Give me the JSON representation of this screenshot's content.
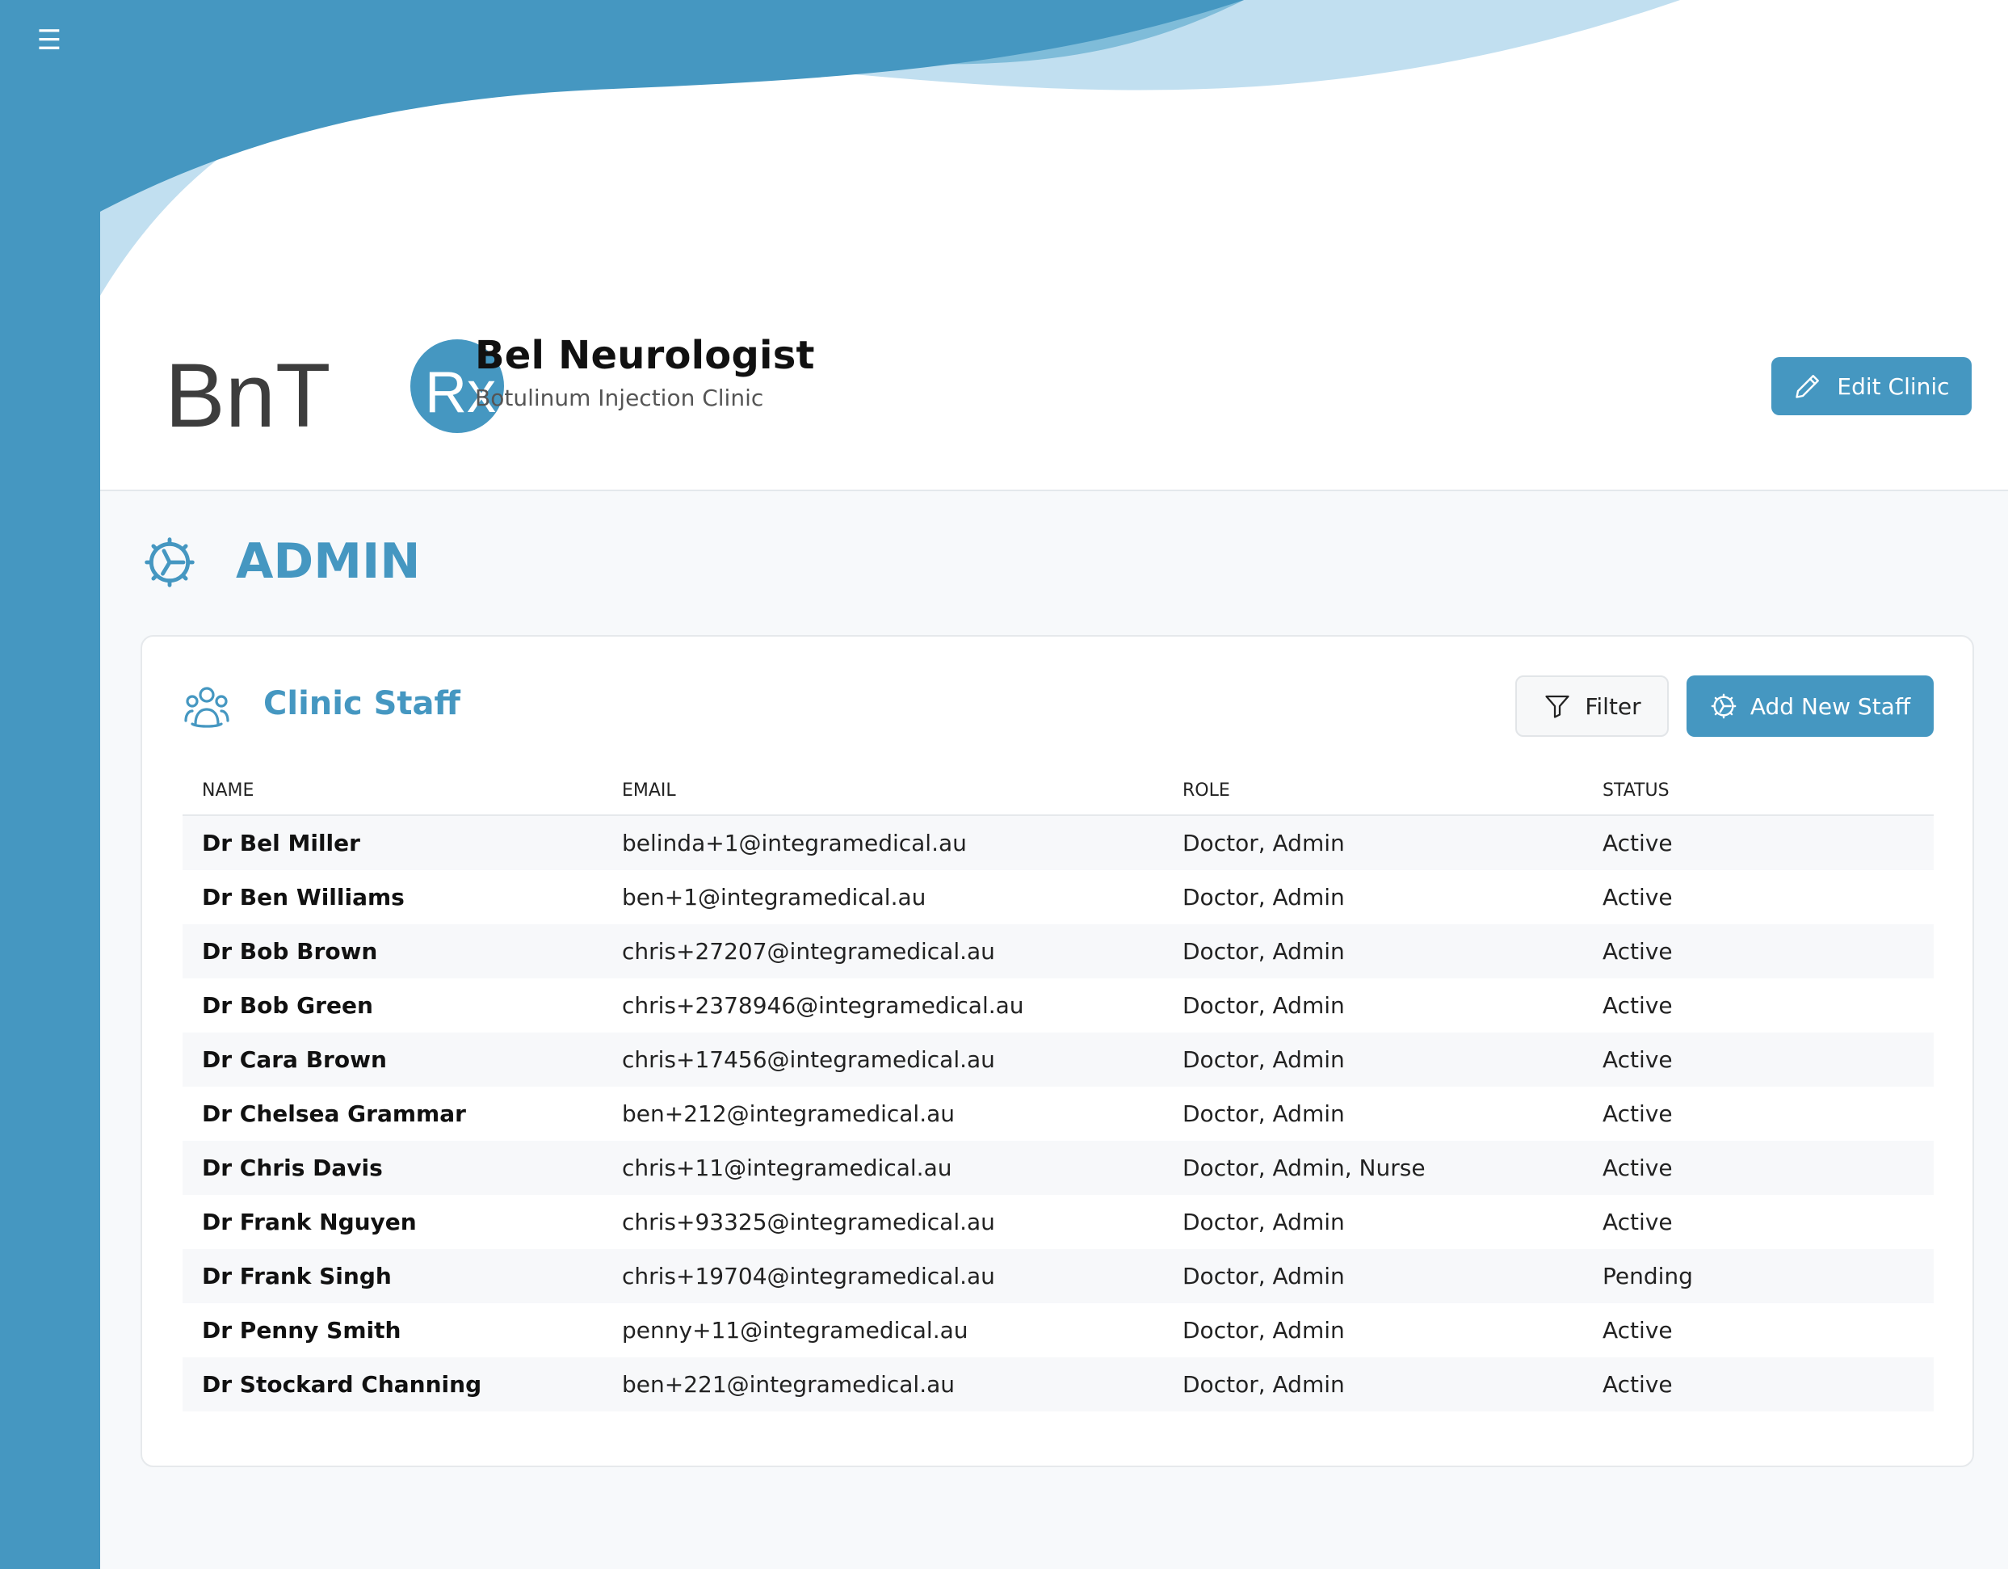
{
  "sidebar": {
    "menu_icon": "hamburger-icon",
    "menu_glyph": "☰"
  },
  "header": {
    "logo": {
      "text": "BnT",
      "badge": "Rx"
    },
    "clinic_name": "Bel Neurologist",
    "clinic_subtitle": "Botulinum Injection Clinic",
    "edit_button": "Edit Clinic"
  },
  "section": {
    "title": "ADMIN",
    "icon": "gear-icon"
  },
  "staff": {
    "title": "Clinic Staff",
    "icon": "users-icon",
    "filter_button": "Filter",
    "add_button": "Add New Staff",
    "columns": [
      "NAME",
      "EMAIL",
      "ROLE",
      "STATUS"
    ],
    "rows": [
      {
        "name": "Dr Bel Miller",
        "email": "belinda+1@integramedical.au",
        "role": "Doctor, Admin",
        "status": "Active"
      },
      {
        "name": "Dr Ben Williams",
        "email": "ben+1@integramedical.au",
        "role": "Doctor, Admin",
        "status": "Active"
      },
      {
        "name": "Dr Bob Brown",
        "email": "chris+27207@integramedical.au",
        "role": "Doctor, Admin",
        "status": "Active"
      },
      {
        "name": "Dr Bob Green",
        "email": "chris+2378946@integramedical.au",
        "role": "Doctor, Admin",
        "status": "Active"
      },
      {
        "name": "Dr Cara Brown",
        "email": "chris+17456@integramedical.au",
        "role": "Doctor, Admin",
        "status": "Active"
      },
      {
        "name": "Dr Chelsea Grammar",
        "email": "ben+212@integramedical.au",
        "role": "Doctor, Admin",
        "status": "Active"
      },
      {
        "name": "Dr Chris Davis",
        "email": "chris+11@integramedical.au",
        "role": "Doctor, Admin, Nurse",
        "status": "Active"
      },
      {
        "name": "Dr Frank Nguyen",
        "email": "chris+93325@integramedical.au",
        "role": "Doctor, Admin",
        "status": "Active"
      },
      {
        "name": "Dr Frank Singh",
        "email": "chris+19704@integramedical.au",
        "role": "Doctor, Admin",
        "status": "Pending"
      },
      {
        "name": "Dr Penny Smith",
        "email": "penny+11@integramedical.au",
        "role": "Doctor, Admin",
        "status": "Active"
      },
      {
        "name": "Dr Stockard Channing",
        "email": "ben+221@integramedical.au",
        "role": "Doctor, Admin",
        "status": "Active"
      }
    ]
  },
  "colors": {
    "brand": "#4597c1",
    "wave_light": "#c1dff0",
    "wave_mid": "#7fbcd9",
    "logo_dark": "#3d3d3d"
  }
}
